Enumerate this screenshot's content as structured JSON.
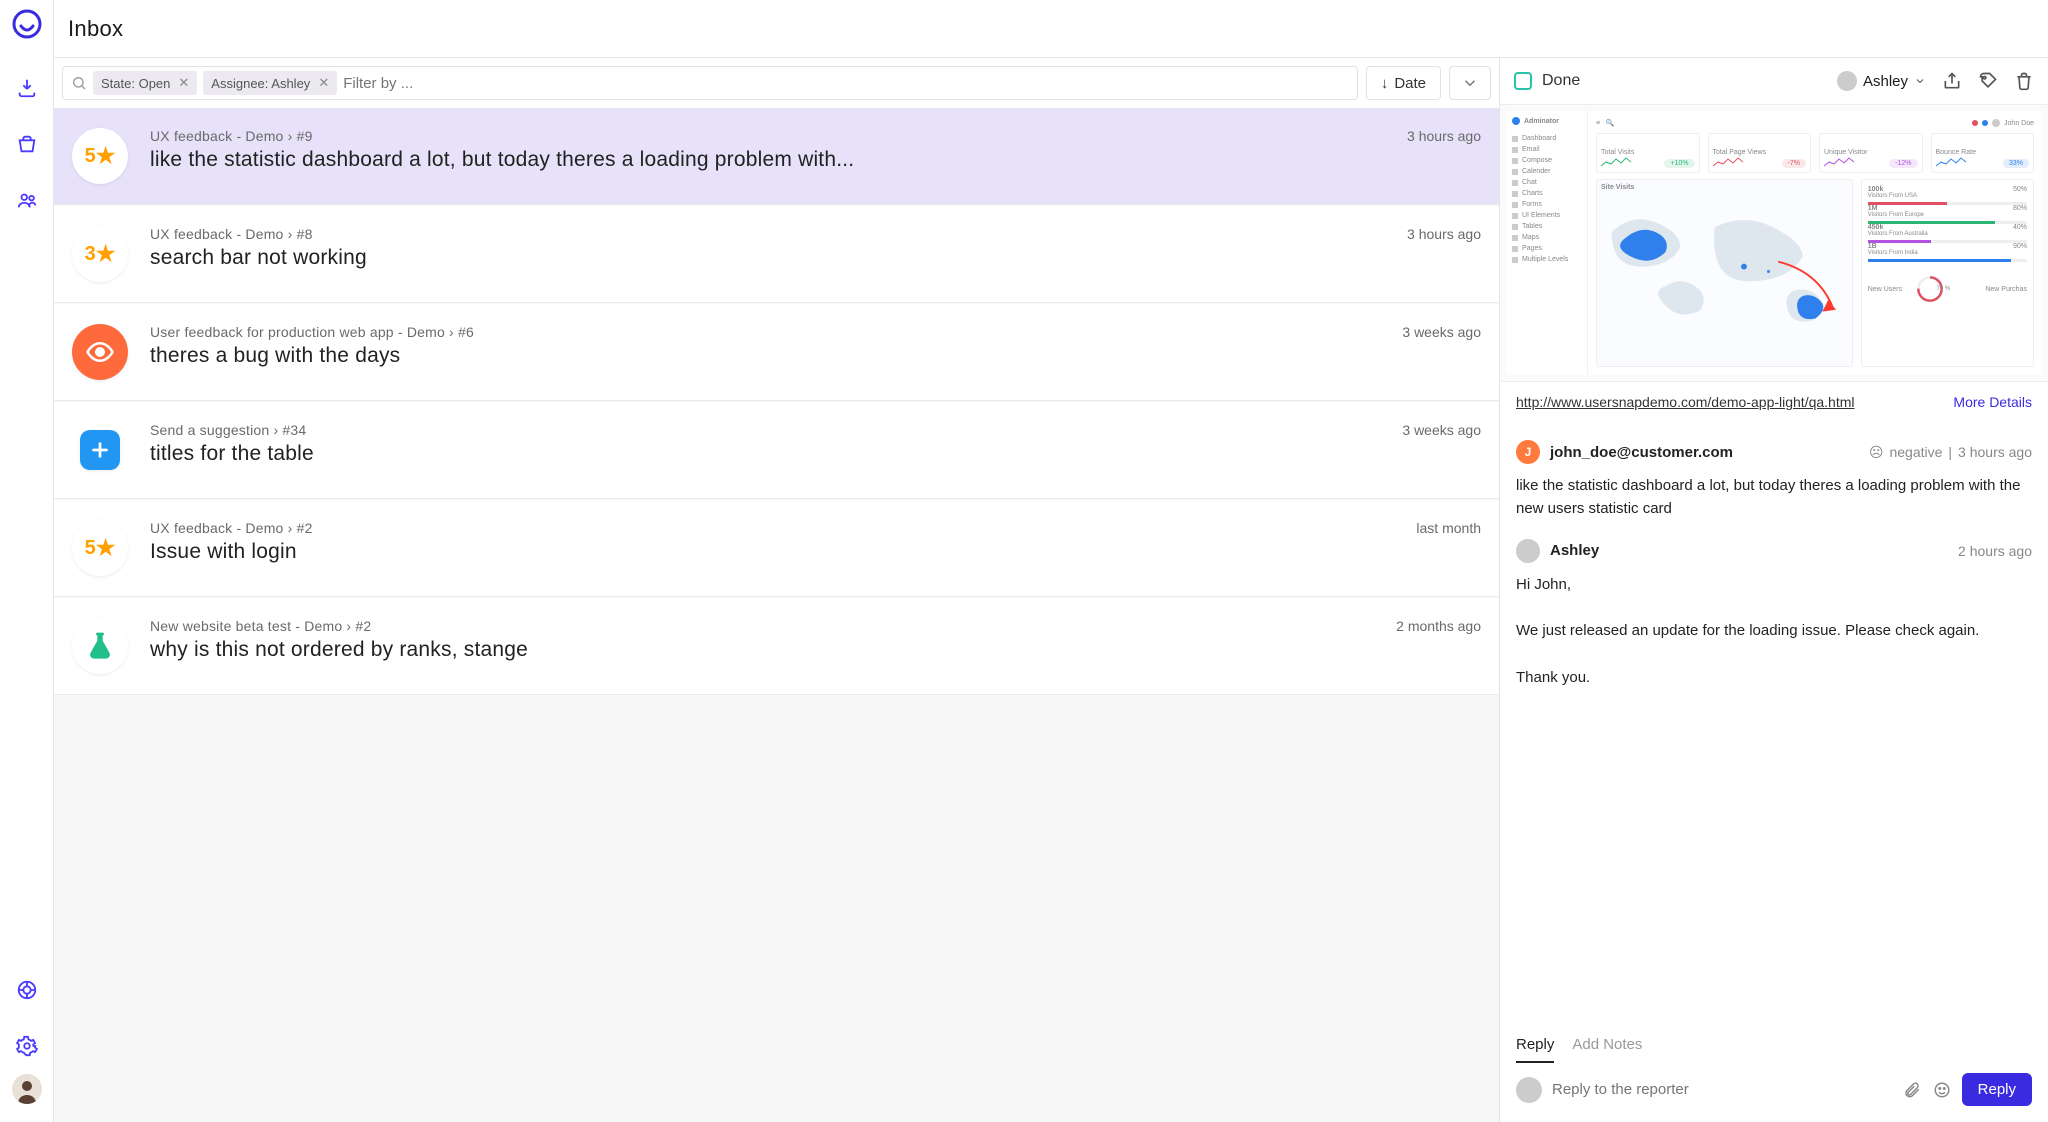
{
  "page_title": "Inbox",
  "filters": {
    "chip_state": "State: Open",
    "chip_assignee": "Assignee: Ashley",
    "placeholder": "Filter by ..."
  },
  "sort_label": "Date",
  "done_label": "Done",
  "assignee_name": "Ashley",
  "items": [
    {
      "source": "UX feedback - Demo › #9",
      "time": "3 hours ago",
      "title": "like the statistic dashboard a lot, but today theres a loading problem with...",
      "badge_type": "rating",
      "rating": "5"
    },
    {
      "source": "UX feedback - Demo › #8",
      "time": "3 hours ago",
      "title": "search bar not working",
      "badge_type": "rating",
      "rating": "3"
    },
    {
      "source": "User feedback for production web app - Demo › #6",
      "time": "3 weeks ago",
      "title": "theres a bug with the days",
      "badge_type": "eye"
    },
    {
      "source": "Send a suggestion › #34",
      "time": "3 weeks ago",
      "title": "titles for the table",
      "badge_type": "add"
    },
    {
      "source": "UX feedback - Demo › #2",
      "time": "last month",
      "title": "Issue with login",
      "badge_type": "rating",
      "rating": "5"
    },
    {
      "source": "New website beta test - Demo › #2",
      "time": "2 months ago",
      "title": "why is this not ordered by ranks, stange",
      "badge_type": "flask"
    }
  ],
  "detail": {
    "url": "http://www.usersnapdemo.com/demo-app-light/qa.html",
    "more": "More Details",
    "reporter_email": "john_doe@customer.com",
    "reporter_initial": "J",
    "sentiment": "negative",
    "reporter_time": "3 hours ago",
    "reporter_msg": "like the statistic dashboard a lot, but today theres a loading problem with the new users statistic card",
    "reply_name": "Ashley",
    "reply_time": "2 hours ago",
    "reply_body_1": "Hi John,",
    "reply_body_2": "We just released an update for the loading issue. Please check again.",
    "reply_body_3": "Thank you.",
    "tab_reply": "Reply",
    "tab_notes": "Add Notes",
    "reply_placeholder": "Reply to the reporter",
    "reply_button": "Reply"
  },
  "mock": {
    "brand": "Adminator",
    "user": "John Doe",
    "nav": [
      "Dashboard",
      "Email",
      "Compose",
      "Calender",
      "Chat",
      "Charts",
      "Forms",
      "UI Elements",
      "Tables",
      "Maps",
      "Pages",
      "Multiple Levels"
    ],
    "cards": [
      {
        "label": "Total Visits",
        "pill": "+10%",
        "pill_color": "#2bb673"
      },
      {
        "label": "Total Page Views",
        "pill": "-7%",
        "pill_color": "#e05263"
      },
      {
        "label": "Unique Visitor",
        "pill": "-12%",
        "pill_color": "#b152e0"
      },
      {
        "label": "Bounce Rate",
        "pill": "33%",
        "pill_color": "#2f80ed"
      }
    ],
    "map_title": "Site Visits",
    "stats": [
      {
        "label": "Visitors From USA",
        "value": "100k",
        "pct": "50%",
        "color": "#e05263"
      },
      {
        "label": "Visitors From Europe",
        "value": "1M",
        "pct": "80%",
        "color": "#2bb673"
      },
      {
        "label": "Visitors From Australia",
        "value": "450k",
        "pct": "40%",
        "color": "#b152e0"
      },
      {
        "label": "Visitors From India",
        "value": "1B",
        "pct": "90%",
        "color": "#2f80ed"
      }
    ],
    "ring_pct": "75 %",
    "ring_l": "New Users",
    "ring_r": "New Purchas"
  }
}
